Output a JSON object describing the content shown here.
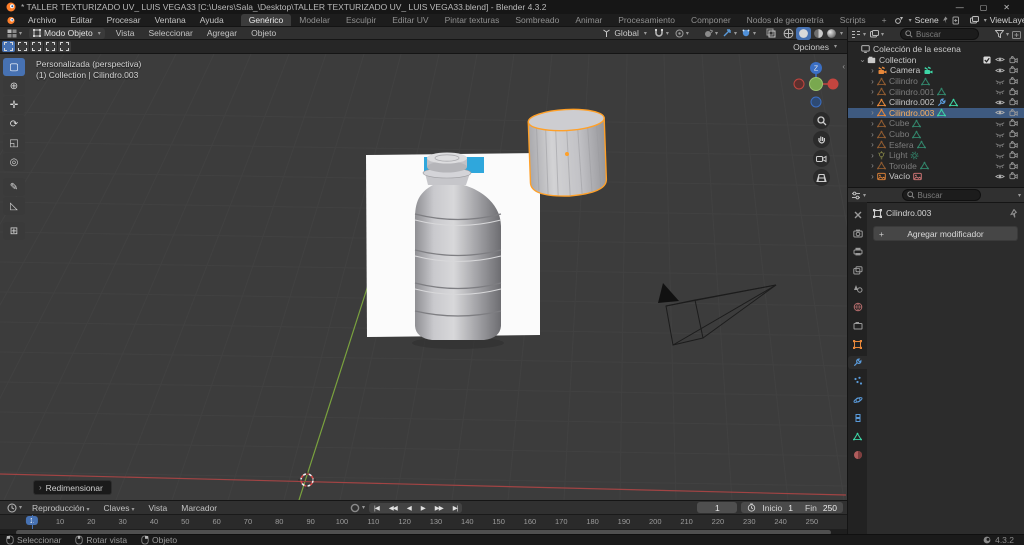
{
  "colors": {
    "accent": "#4772b3",
    "object_orange": "#e8883a",
    "active_text_orange": "#ffb25e",
    "data_green": "#3dd6a6",
    "selection_outline": "#ffa028",
    "axis_red": "#a24444",
    "axis_green": "#7aa23e",
    "modifier_blue": "#5a9ad9"
  },
  "titlebar": {
    "title": "* TALLER TEXTURIZADO UV_ LUIS VEGA33 [C:\\Users\\Sala_\\Desktop\\TALLER TEXTURIZADO UV_ LUIS VEGA33.blend] - Blender 4.3.2",
    "window_buttons": [
      "minimize",
      "maximize",
      "close"
    ]
  },
  "topbar": {
    "menus": [
      "Archivo",
      "Editar",
      "Procesar",
      "Ventana",
      "Ayuda"
    ],
    "workspaces": [
      "Genérico",
      "Modelar",
      "Esculpir",
      "Editar UV",
      "Pintar texturas",
      "Sombreado",
      "Animar",
      "Procesamiento",
      "Componer",
      "Nodos de geometría",
      "Scripts"
    ],
    "active_workspace": "Genérico",
    "new_workspace_label": "+",
    "scene_name": "Scene",
    "view_layer_name": "ViewLayer"
  },
  "viewport_header": {
    "mode_label": "Modo Objeto",
    "menus": [
      "Vista",
      "Seleccionar",
      "Agregar",
      "Objeto"
    ],
    "orientation_label": "Global",
    "options_label": "Opciones"
  },
  "viewport": {
    "view_label": "Personalizada (perspectiva)",
    "context_label": "(1) Collection | Cilindro.003",
    "operator_panel_label": "Redimensionar",
    "tools": [
      "select-box",
      "cursor",
      "move",
      "rotate",
      "scale",
      "transform",
      "annotate",
      "measure",
      "add-cube"
    ],
    "tool_glyphs": [
      "▢",
      "⊕",
      "✛",
      "⟳",
      "◱",
      "◎",
      "✎",
      "◺",
      "⊞"
    ],
    "nav_buttons": [
      "zoom",
      "pan",
      "camera-view",
      "perspective-toggle"
    ]
  },
  "outliner": {
    "search_placeholder": "Buscar",
    "scene_collection_label": "Colección de la escena",
    "collection_name": "Collection",
    "items": [
      {
        "name": "Camera",
        "type": "camera",
        "dimmed": false,
        "selected": false,
        "visible": true,
        "extra": [
          "camera-data"
        ]
      },
      {
        "name": "Cilindro",
        "type": "mesh",
        "dimmed": true,
        "selected": false,
        "visible": false,
        "extra": [
          "mesh-data"
        ]
      },
      {
        "name": "Cilindro.001",
        "type": "mesh",
        "dimmed": true,
        "selected": false,
        "visible": false,
        "extra": [
          "mesh-data"
        ]
      },
      {
        "name": "Cilindro.002",
        "type": "mesh",
        "dimmed": false,
        "selected": false,
        "visible": true,
        "extra": [
          "modifier",
          "mesh-data"
        ]
      },
      {
        "name": "Cilindro.003",
        "type": "mesh",
        "dimmed": false,
        "selected": true,
        "visible": true,
        "extra": [
          "mesh-data"
        ]
      },
      {
        "name": "Cube",
        "type": "mesh",
        "dimmed": true,
        "selected": false,
        "visible": false,
        "extra": [
          "mesh-data"
        ]
      },
      {
        "name": "Cubo",
        "type": "mesh",
        "dimmed": true,
        "selected": false,
        "visible": false,
        "extra": [
          "mesh-data"
        ]
      },
      {
        "name": "Esfera",
        "type": "mesh",
        "dimmed": true,
        "selected": false,
        "visible": false,
        "extra": [
          "mesh-data"
        ]
      },
      {
        "name": "Light",
        "type": "light",
        "dimmed": true,
        "selected": false,
        "visible": false,
        "extra": [
          "light-data"
        ]
      },
      {
        "name": "Toroide",
        "type": "mesh",
        "dimmed": true,
        "selected": false,
        "visible": false,
        "extra": [
          "mesh-data"
        ]
      },
      {
        "name": "Vacío",
        "type": "empty-image",
        "dimmed": false,
        "selected": false,
        "visible": true,
        "extra": [
          "image-data"
        ]
      }
    ]
  },
  "properties": {
    "search_placeholder": "Buscar",
    "tabs": [
      "tool",
      "render",
      "output",
      "view-layer",
      "scene",
      "world",
      "collection",
      "object",
      "modifiers",
      "particles",
      "physics",
      "constraints",
      "data",
      "material"
    ],
    "active_tab": "modifiers",
    "breadcrumb_object": "Cilindro.003",
    "add_modifier_label": "Agregar modificador",
    "add_modifier_plus": "+"
  },
  "timeline": {
    "menus": [
      {
        "label": "Reproducción",
        "caret": true
      },
      {
        "label": "Claves",
        "caret": true
      },
      {
        "label": "Vista",
        "caret": false
      },
      {
        "label": "Marcador",
        "caret": false
      }
    ],
    "playback_buttons": [
      "|◀",
      "◀◀",
      "◀",
      "▶",
      "▶▶",
      "▶|"
    ],
    "current_frame": "1",
    "start_label": "Inicio",
    "start_value": "1",
    "end_label": "Fin",
    "end_value": "250",
    "ruler_ticks": [
      1,
      10,
      20,
      30,
      40,
      50,
      60,
      70,
      80,
      90,
      100,
      110,
      120,
      130,
      140,
      150,
      160,
      170,
      180,
      190,
      200,
      210,
      220,
      230,
      240,
      250
    ]
  },
  "statusbar": {
    "hints": [
      {
        "icon": "mouse-left",
        "label": "Seleccionar"
      },
      {
        "icon": "mouse-middle",
        "label": "Rotar vista"
      },
      {
        "icon": "mouse-right",
        "label": "Objeto"
      }
    ],
    "version": "4.3.2"
  }
}
